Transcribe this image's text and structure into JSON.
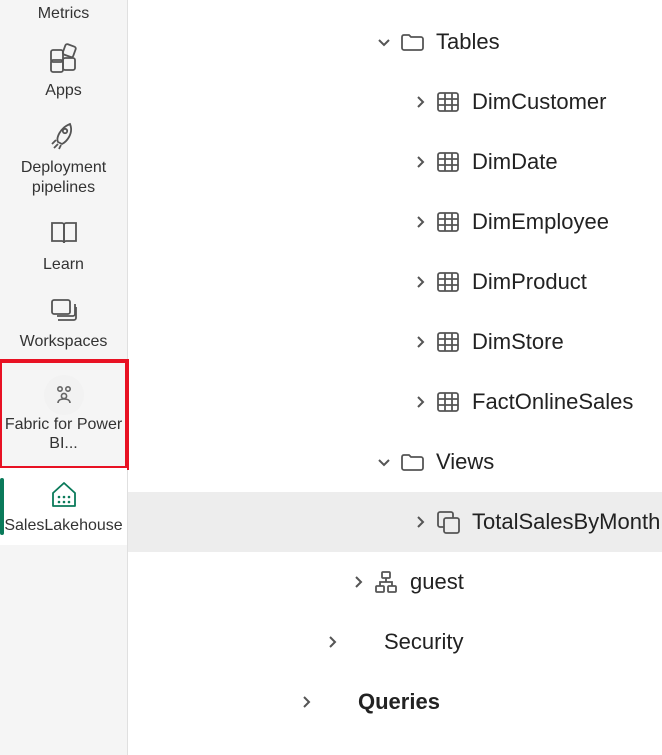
{
  "sidebar": {
    "metrics": "Metrics",
    "apps": "Apps",
    "deployment": "Deployment pipelines",
    "learn": "Learn",
    "workspaces": "Workspaces",
    "fabric": "Fabric for Power BI...",
    "saleslakehouse": "SalesLakehouse"
  },
  "tree": {
    "tables": "Tables",
    "dimCustomer": "DimCustomer",
    "dimDate": "DimDate",
    "dimEmployee": "DimEmployee",
    "dimProduct": "DimProduct",
    "dimStore": "DimStore",
    "factOnlineSales": "FactOnlineSales",
    "views": "Views",
    "totalSalesByMonth": "TotalSalesByMonth",
    "guest": "guest",
    "security": "Security",
    "queries": "Queries"
  }
}
